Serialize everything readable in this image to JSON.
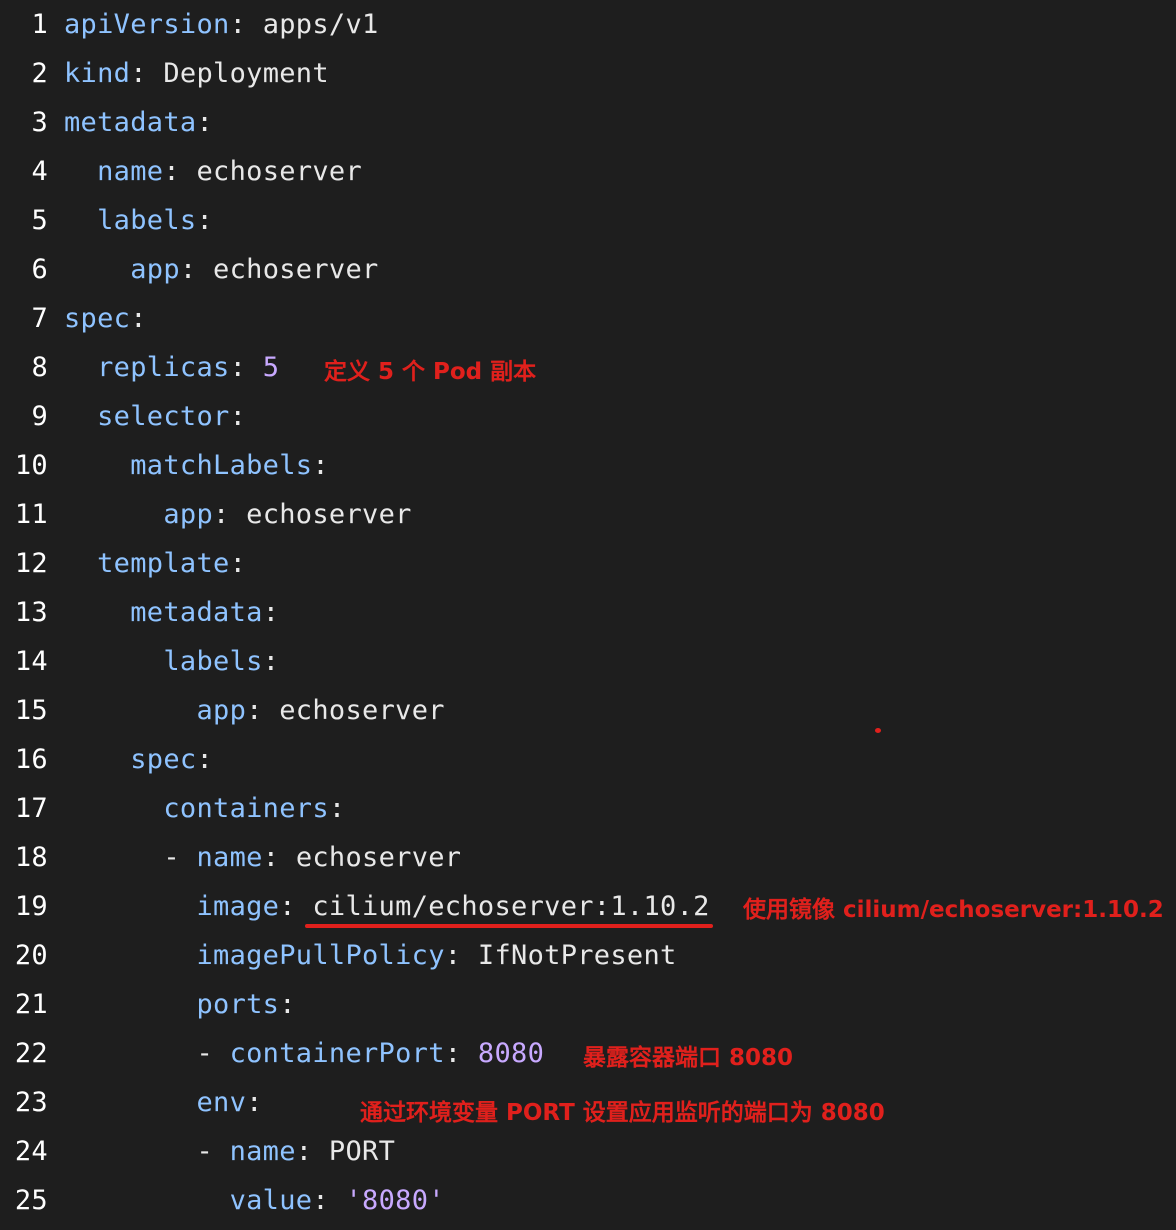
{
  "lines": [
    {
      "n": "1",
      "indent": "",
      "key": "apiVersion",
      "sep": ": ",
      "value": "apps/v1"
    },
    {
      "n": "2",
      "indent": "",
      "key": "kind",
      "sep": ": ",
      "value": "Deployment"
    },
    {
      "n": "3",
      "indent": "",
      "key": "metadata",
      "sep": ":",
      "value": ""
    },
    {
      "n": "4",
      "indent": "  ",
      "key": "name",
      "sep": ": ",
      "value": "echoserver"
    },
    {
      "n": "5",
      "indent": "  ",
      "key": "labels",
      "sep": ":",
      "value": ""
    },
    {
      "n": "6",
      "indent": "    ",
      "key": "app",
      "sep": ": ",
      "value": "echoserver"
    },
    {
      "n": "7",
      "indent": "",
      "key": "spec",
      "sep": ":",
      "value": ""
    },
    {
      "n": "8",
      "indent": "  ",
      "key": "replicas",
      "sep": ": ",
      "value": "5",
      "value_type": "num"
    },
    {
      "n": "9",
      "indent": "  ",
      "key": "selector",
      "sep": ":",
      "value": ""
    },
    {
      "n": "10",
      "indent": "    ",
      "key": "matchLabels",
      "sep": ":",
      "value": ""
    },
    {
      "n": "11",
      "indent": "      ",
      "key": "app",
      "sep": ": ",
      "value": "echoserver"
    },
    {
      "n": "12",
      "indent": "  ",
      "key": "template",
      "sep": ":",
      "value": ""
    },
    {
      "n": "13",
      "indent": "    ",
      "key": "metadata",
      "sep": ":",
      "value": ""
    },
    {
      "n": "14",
      "indent": "      ",
      "key": "labels",
      "sep": ":",
      "value": ""
    },
    {
      "n": "15",
      "indent": "        ",
      "key": "app",
      "sep": ": ",
      "value": "echoserver"
    },
    {
      "n": "16",
      "indent": "    ",
      "key": "spec",
      "sep": ":",
      "value": ""
    },
    {
      "n": "17",
      "indent": "      ",
      "key": "containers",
      "sep": ":",
      "value": ""
    },
    {
      "n": "18",
      "indent": "      - ",
      "key": "name",
      "sep": ": ",
      "value": "echoserver"
    },
    {
      "n": "19",
      "indent": "        ",
      "key": "image",
      "sep": ": ",
      "value": "cilium/echoserver:1.10.2"
    },
    {
      "n": "20",
      "indent": "        ",
      "key": "imagePullPolicy",
      "sep": ": ",
      "value": "IfNotPresent"
    },
    {
      "n": "21",
      "indent": "        ",
      "key": "ports",
      "sep": ":",
      "value": ""
    },
    {
      "n": "22",
      "indent": "        - ",
      "key": "containerPort",
      "sep": ": ",
      "value": "8080",
      "value_type": "num"
    },
    {
      "n": "23",
      "indent": "        ",
      "key": "env",
      "sep": ":",
      "value": ""
    },
    {
      "n": "24",
      "indent": "        - ",
      "key": "name",
      "sep": ": ",
      "value": "PORT"
    },
    {
      "n": "25",
      "indent": "          ",
      "key": "value",
      "sep": ": ",
      "value": "'8080'",
      "value_type": "num"
    }
  ],
  "annotations": {
    "replicas": "定义 5 个 Pod 副本",
    "image": "使用镜像 cilium/echoserver:1.10.2",
    "port": "暴露容器端口 8080",
    "env": "通过环境变量 PORT 设置应用监听的端口为 8080"
  },
  "colors": {
    "background": "#1e1e1e",
    "key": "#8fc3ff",
    "number": "#c8a9ff",
    "annotation": "#e0201c"
  }
}
